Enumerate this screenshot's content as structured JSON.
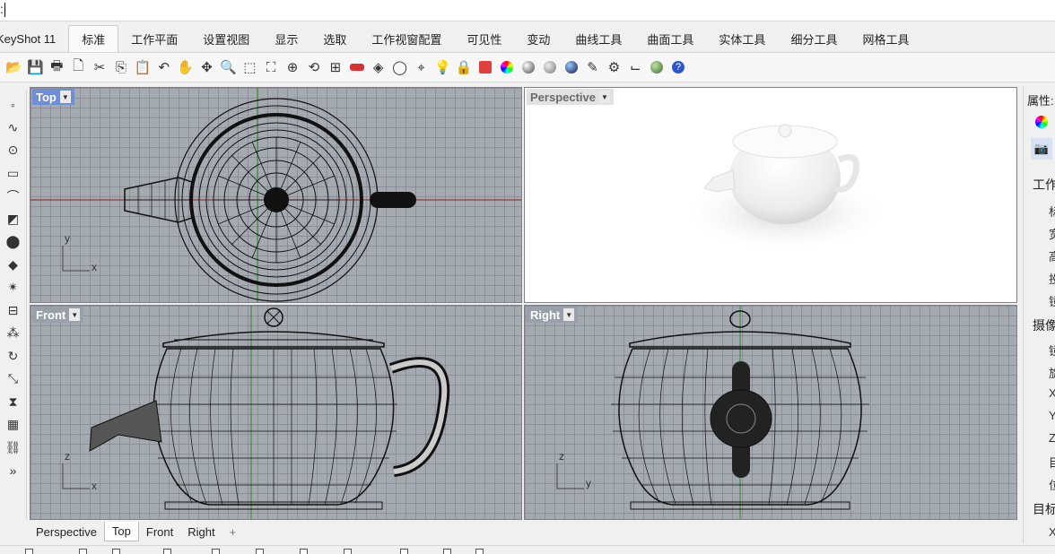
{
  "command": {
    "prompt": ":"
  },
  "tabs": [
    {
      "label": "KeyShot 11"
    },
    {
      "label": "标准",
      "active": true
    },
    {
      "label": "工作平面"
    },
    {
      "label": "设置视图"
    },
    {
      "label": "显示"
    },
    {
      "label": "选取"
    },
    {
      "label": "工作视窗配置"
    },
    {
      "label": "可见性"
    },
    {
      "label": "变动"
    },
    {
      "label": "曲线工具"
    },
    {
      "label": "曲面工具"
    },
    {
      "label": "实体工具"
    },
    {
      "label": "细分工具"
    },
    {
      "label": "网格工具"
    }
  ],
  "toolbar": {
    "icons": [
      "open-icon",
      "save-icon",
      "print-icon",
      "import-icon",
      "cut-icon",
      "copy-icon",
      "paste-icon",
      "undo-icon",
      "pan-hand-icon",
      "rotate-view-icon",
      "zoom-icon",
      "zoom-window-icon",
      "zoom-extents-icon",
      "zoom-selected-icon",
      "rotate-icon",
      "four-view-icon",
      "car-icon",
      "shade-icon",
      "circle-icon",
      "snap-icon",
      "light-bulb-icon",
      "lock-icon",
      "material-icon",
      "color-wheel-icon",
      "sphere-icon",
      "shaded-sphere-icon",
      "blue-sphere-icon",
      "pen-icon",
      "gear-icon",
      "dimension-icon",
      "render-icon",
      "help-icon"
    ]
  },
  "left_toolbar": {
    "icons": [
      "point-icon",
      "curve-icon",
      "circle-icon",
      "rectangle-icon",
      "arc-icon",
      "surface-icon",
      "solid-icon",
      "mesh-icon",
      "explode-icon",
      "boolean-icon",
      "array-icon",
      "rotate-icon",
      "scale-icon",
      "mirror-icon",
      "grid-icon",
      "join-icon",
      "more-icon"
    ]
  },
  "viewports": {
    "top": {
      "label": "Top"
    },
    "perspective": {
      "label": "Perspective"
    },
    "front": {
      "label": "Front"
    },
    "right": {
      "label": "Right"
    }
  },
  "axes": {
    "top": {
      "v": "y",
      "h": "x"
    },
    "front": {
      "v": "z",
      "h": "x"
    },
    "right": {
      "v": "z",
      "h": "y"
    }
  },
  "right_panel": {
    "title": "属性:",
    "items": [
      "工作",
      "标",
      "宽",
      "高",
      "投",
      "镜",
      "摄像",
      "镜",
      "旋",
      "X",
      "Y",
      "Z",
      "目",
      "位",
      "目标",
      "X"
    ]
  },
  "viewport_tabs": [
    {
      "label": "Perspective"
    },
    {
      "label": "Top",
      "active": true
    },
    {
      "label": "Front"
    },
    {
      "label": "Right"
    },
    {
      "label": "+"
    }
  ],
  "colors": {
    "viewport_bg": "#a5a9b0",
    "active_label": "#6f8ed6",
    "x_axis": "#c02020",
    "y_axis": "#20a020"
  }
}
